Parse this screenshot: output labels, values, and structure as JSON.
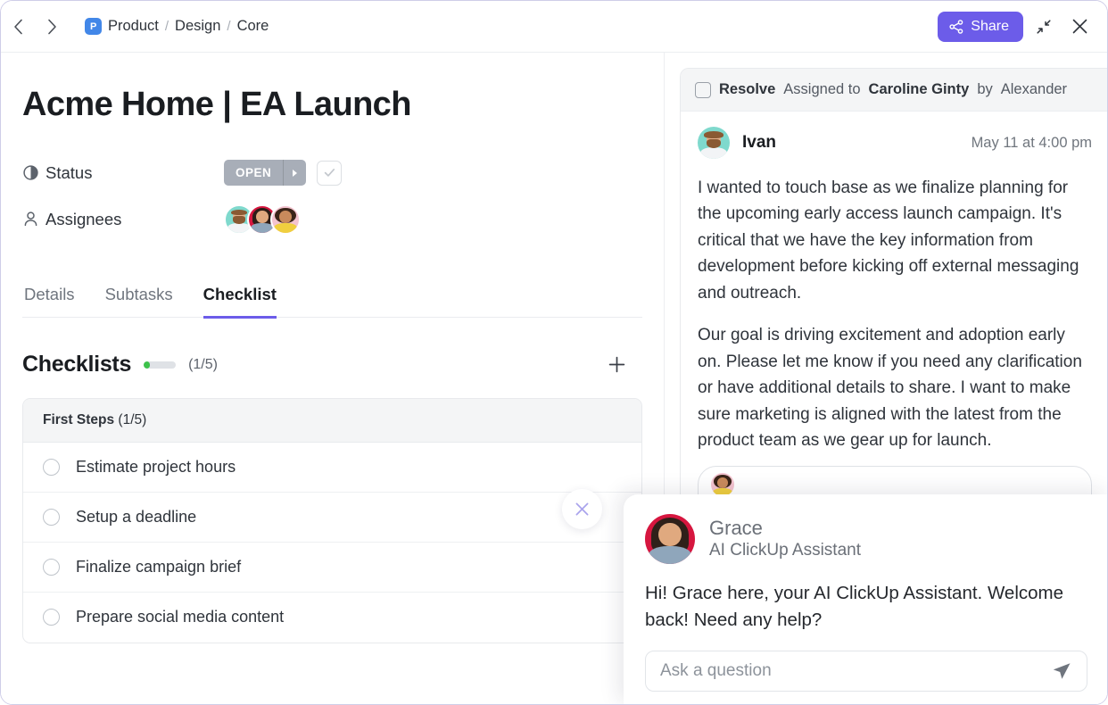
{
  "topbar": {
    "back_icon": "chevron-left-icon",
    "forward_icon": "chevron-right-icon",
    "breadcrumb": {
      "logo_letter": "P",
      "items": [
        "Product",
        "Design",
        "Core"
      ],
      "separator": "/"
    },
    "share_label": "Share",
    "share_icon": "share-nodes-icon",
    "collapse_icon": "collapse-arrows-icon",
    "close_icon": "close-icon",
    "accent_color": "#6c5ce9"
  },
  "task": {
    "title": "Acme Home | EA Launch",
    "fields": [
      {
        "label": "Status",
        "icon": "status-clock-icon"
      },
      {
        "label": "Assignees",
        "icon": "person-icon"
      }
    ],
    "status": {
      "value": "OPEN",
      "caret_icon": "caret-right-icon",
      "color": "#a8aeb8",
      "complete_icon": "check-icon"
    },
    "assignees": [
      {
        "name": "Ivan",
        "bg": "#7fd9cd",
        "hair": "#8a5a33",
        "skin": "#e3b08c",
        "shirt": "#f2f4f6"
      },
      {
        "name": "Caroline Ginty",
        "bg": "#d6163f",
        "hair": "#2c1d17",
        "skin": "#e0a97f",
        "shirt": "#8fa6bb"
      },
      {
        "name": "Alexander",
        "bg": "#f3c3cf",
        "hair": "#3a2418",
        "skin": "#c98a5c",
        "shirt": "#f0cf3f"
      }
    ]
  },
  "tabs": [
    {
      "label": "Details",
      "active": false
    },
    {
      "label": "Subtasks",
      "active": false
    },
    {
      "label": "Checklist",
      "active": true
    }
  ],
  "checklists": {
    "heading": "Checklists",
    "count_label": "(1/5)",
    "progress_percent": 20,
    "progress_color": "#3dc24b",
    "add_icon": "plus-icon",
    "group": {
      "name": "First Steps",
      "count_label": "(1/5)"
    },
    "items": [
      {
        "label": "Estimate project hours",
        "checked": false
      },
      {
        "label": "Setup a deadline",
        "checked": false
      },
      {
        "label": "Finalize campaign brief",
        "checked": false
      },
      {
        "label": "Prepare social media content",
        "checked": false
      }
    ]
  },
  "comment": {
    "resolve_label": "Resolve",
    "assigned_prefix": "Assigned to",
    "assignee": "Caroline Ginty",
    "by_prefix": "by",
    "assigner": "Alexander",
    "author": "Ivan",
    "timestamp": "May 11 at 4:00 pm",
    "paragraphs": [
      "I wanted to touch base as we finalize planning for the upcoming early access launch campaign. It's critical that we have the key information from development before kicking off external messaging and outreach.",
      "Our goal is driving excitement and adoption early on. Please let me know if you need any clarification or have additional details to share. I want to make sure marketing is aligned with the latest from the product team as we gear up for launch."
    ]
  },
  "floating": {
    "close_icon": "close-icon",
    "close_color": "#a9a3ec"
  },
  "grace": {
    "name": "Grace",
    "role": "AI ClickUp Assistant",
    "greeting": "Hi! Grace here, your AI ClickUp Assistant. Welcome back! Need any help?",
    "input_placeholder": "Ask a question",
    "input_value": "",
    "send_icon": "send-paper-plane-icon",
    "avatar_bg": "#d6163f"
  }
}
